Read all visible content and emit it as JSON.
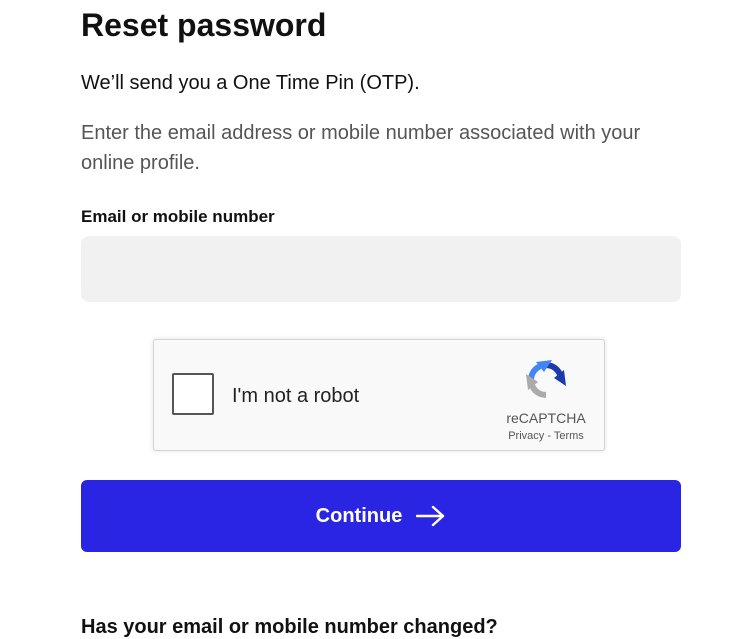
{
  "page": {
    "title": "Reset password",
    "lead": "We’ll send you a One Time Pin (OTP).",
    "description": "Enter the email address or mobile number associated with your online profile."
  },
  "form": {
    "field_label": "Email or mobile number",
    "field_value": "",
    "field_placeholder": ""
  },
  "captcha": {
    "label": "I'm not a robot",
    "brand": "reCAPTCHA",
    "privacy_link": "Privacy",
    "separator": "-",
    "terms_link": "Terms",
    "logo_icon": "recaptcha-logo-icon",
    "checked": false
  },
  "actions": {
    "continue_label": "Continue",
    "continue_icon": "arrow-right-icon"
  },
  "footer": {
    "changed_heading": "Has your email or mobile number changed?"
  },
  "colors": {
    "primary_button": "#2a25e3",
    "input_background": "#f1f1f1",
    "body_text": "#111111",
    "muted_text": "#555555"
  }
}
